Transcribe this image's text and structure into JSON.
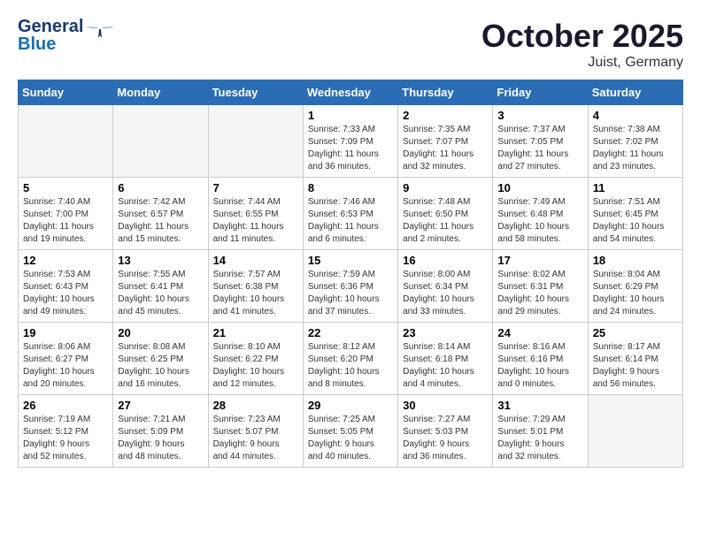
{
  "header": {
    "logo_line1": "General",
    "logo_line2": "Blue",
    "month": "October 2025",
    "location": "Juist, Germany"
  },
  "weekdays": [
    "Sunday",
    "Monday",
    "Tuesday",
    "Wednesday",
    "Thursday",
    "Friday",
    "Saturday"
  ],
  "weeks": [
    {
      "days": [
        {
          "number": "",
          "info": "",
          "empty": true
        },
        {
          "number": "",
          "info": "",
          "empty": true
        },
        {
          "number": "",
          "info": "",
          "empty": true
        },
        {
          "number": "1",
          "info": "Sunrise: 7:33 AM\nSunset: 7:09 PM\nDaylight: 11 hours\nand 36 minutes.",
          "empty": false
        },
        {
          "number": "2",
          "info": "Sunrise: 7:35 AM\nSunset: 7:07 PM\nDaylight: 11 hours\nand 32 minutes.",
          "empty": false
        },
        {
          "number": "3",
          "info": "Sunrise: 7:37 AM\nSunset: 7:05 PM\nDaylight: 11 hours\nand 27 minutes.",
          "empty": false
        },
        {
          "number": "4",
          "info": "Sunrise: 7:38 AM\nSunset: 7:02 PM\nDaylight: 11 hours\nand 23 minutes.",
          "empty": false
        }
      ]
    },
    {
      "days": [
        {
          "number": "5",
          "info": "Sunrise: 7:40 AM\nSunset: 7:00 PM\nDaylight: 11 hours\nand 19 minutes.",
          "empty": false
        },
        {
          "number": "6",
          "info": "Sunrise: 7:42 AM\nSunset: 6:57 PM\nDaylight: 11 hours\nand 15 minutes.",
          "empty": false
        },
        {
          "number": "7",
          "info": "Sunrise: 7:44 AM\nSunset: 6:55 PM\nDaylight: 11 hours\nand 11 minutes.",
          "empty": false
        },
        {
          "number": "8",
          "info": "Sunrise: 7:46 AM\nSunset: 6:53 PM\nDaylight: 11 hours\nand 6 minutes.",
          "empty": false
        },
        {
          "number": "9",
          "info": "Sunrise: 7:48 AM\nSunset: 6:50 PM\nDaylight: 11 hours\nand 2 minutes.",
          "empty": false
        },
        {
          "number": "10",
          "info": "Sunrise: 7:49 AM\nSunset: 6:48 PM\nDaylight: 10 hours\nand 58 minutes.",
          "empty": false
        },
        {
          "number": "11",
          "info": "Sunrise: 7:51 AM\nSunset: 6:45 PM\nDaylight: 10 hours\nand 54 minutes.",
          "empty": false
        }
      ]
    },
    {
      "days": [
        {
          "number": "12",
          "info": "Sunrise: 7:53 AM\nSunset: 6:43 PM\nDaylight: 10 hours\nand 49 minutes.",
          "empty": false
        },
        {
          "number": "13",
          "info": "Sunrise: 7:55 AM\nSunset: 6:41 PM\nDaylight: 10 hours\nand 45 minutes.",
          "empty": false
        },
        {
          "number": "14",
          "info": "Sunrise: 7:57 AM\nSunset: 6:38 PM\nDaylight: 10 hours\nand 41 minutes.",
          "empty": false
        },
        {
          "number": "15",
          "info": "Sunrise: 7:59 AM\nSunset: 6:36 PM\nDaylight: 10 hours\nand 37 minutes.",
          "empty": false
        },
        {
          "number": "16",
          "info": "Sunrise: 8:00 AM\nSunset: 6:34 PM\nDaylight: 10 hours\nand 33 minutes.",
          "empty": false
        },
        {
          "number": "17",
          "info": "Sunrise: 8:02 AM\nSunset: 6:31 PM\nDaylight: 10 hours\nand 29 minutes.",
          "empty": false
        },
        {
          "number": "18",
          "info": "Sunrise: 8:04 AM\nSunset: 6:29 PM\nDaylight: 10 hours\nand 24 minutes.",
          "empty": false
        }
      ]
    },
    {
      "days": [
        {
          "number": "19",
          "info": "Sunrise: 8:06 AM\nSunset: 6:27 PM\nDaylight: 10 hours\nand 20 minutes.",
          "empty": false
        },
        {
          "number": "20",
          "info": "Sunrise: 8:08 AM\nSunset: 6:25 PM\nDaylight: 10 hours\nand 16 minutes.",
          "empty": false
        },
        {
          "number": "21",
          "info": "Sunrise: 8:10 AM\nSunset: 6:22 PM\nDaylight: 10 hours\nand 12 minutes.",
          "empty": false
        },
        {
          "number": "22",
          "info": "Sunrise: 8:12 AM\nSunset: 6:20 PM\nDaylight: 10 hours\nand 8 minutes.",
          "empty": false
        },
        {
          "number": "23",
          "info": "Sunrise: 8:14 AM\nSunset: 6:18 PM\nDaylight: 10 hours\nand 4 minutes.",
          "empty": false
        },
        {
          "number": "24",
          "info": "Sunrise: 8:16 AM\nSunset: 6:16 PM\nDaylight: 10 hours\nand 0 minutes.",
          "empty": false
        },
        {
          "number": "25",
          "info": "Sunrise: 8:17 AM\nSunset: 6:14 PM\nDaylight: 9 hours\nand 56 minutes.",
          "empty": false
        }
      ]
    },
    {
      "days": [
        {
          "number": "26",
          "info": "Sunrise: 7:19 AM\nSunset: 5:12 PM\nDaylight: 9 hours\nand 52 minutes.",
          "empty": false
        },
        {
          "number": "27",
          "info": "Sunrise: 7:21 AM\nSunset: 5:09 PM\nDaylight: 9 hours\nand 48 minutes.",
          "empty": false
        },
        {
          "number": "28",
          "info": "Sunrise: 7:23 AM\nSunset: 5:07 PM\nDaylight: 9 hours\nand 44 minutes.",
          "empty": false
        },
        {
          "number": "29",
          "info": "Sunrise: 7:25 AM\nSunset: 5:05 PM\nDaylight: 9 hours\nand 40 minutes.",
          "empty": false
        },
        {
          "number": "30",
          "info": "Sunrise: 7:27 AM\nSunset: 5:03 PM\nDaylight: 9 hours\nand 36 minutes.",
          "empty": false
        },
        {
          "number": "31",
          "info": "Sunrise: 7:29 AM\nSunset: 5:01 PM\nDaylight: 9 hours\nand 32 minutes.",
          "empty": false
        },
        {
          "number": "",
          "info": "",
          "empty": true
        }
      ]
    }
  ]
}
